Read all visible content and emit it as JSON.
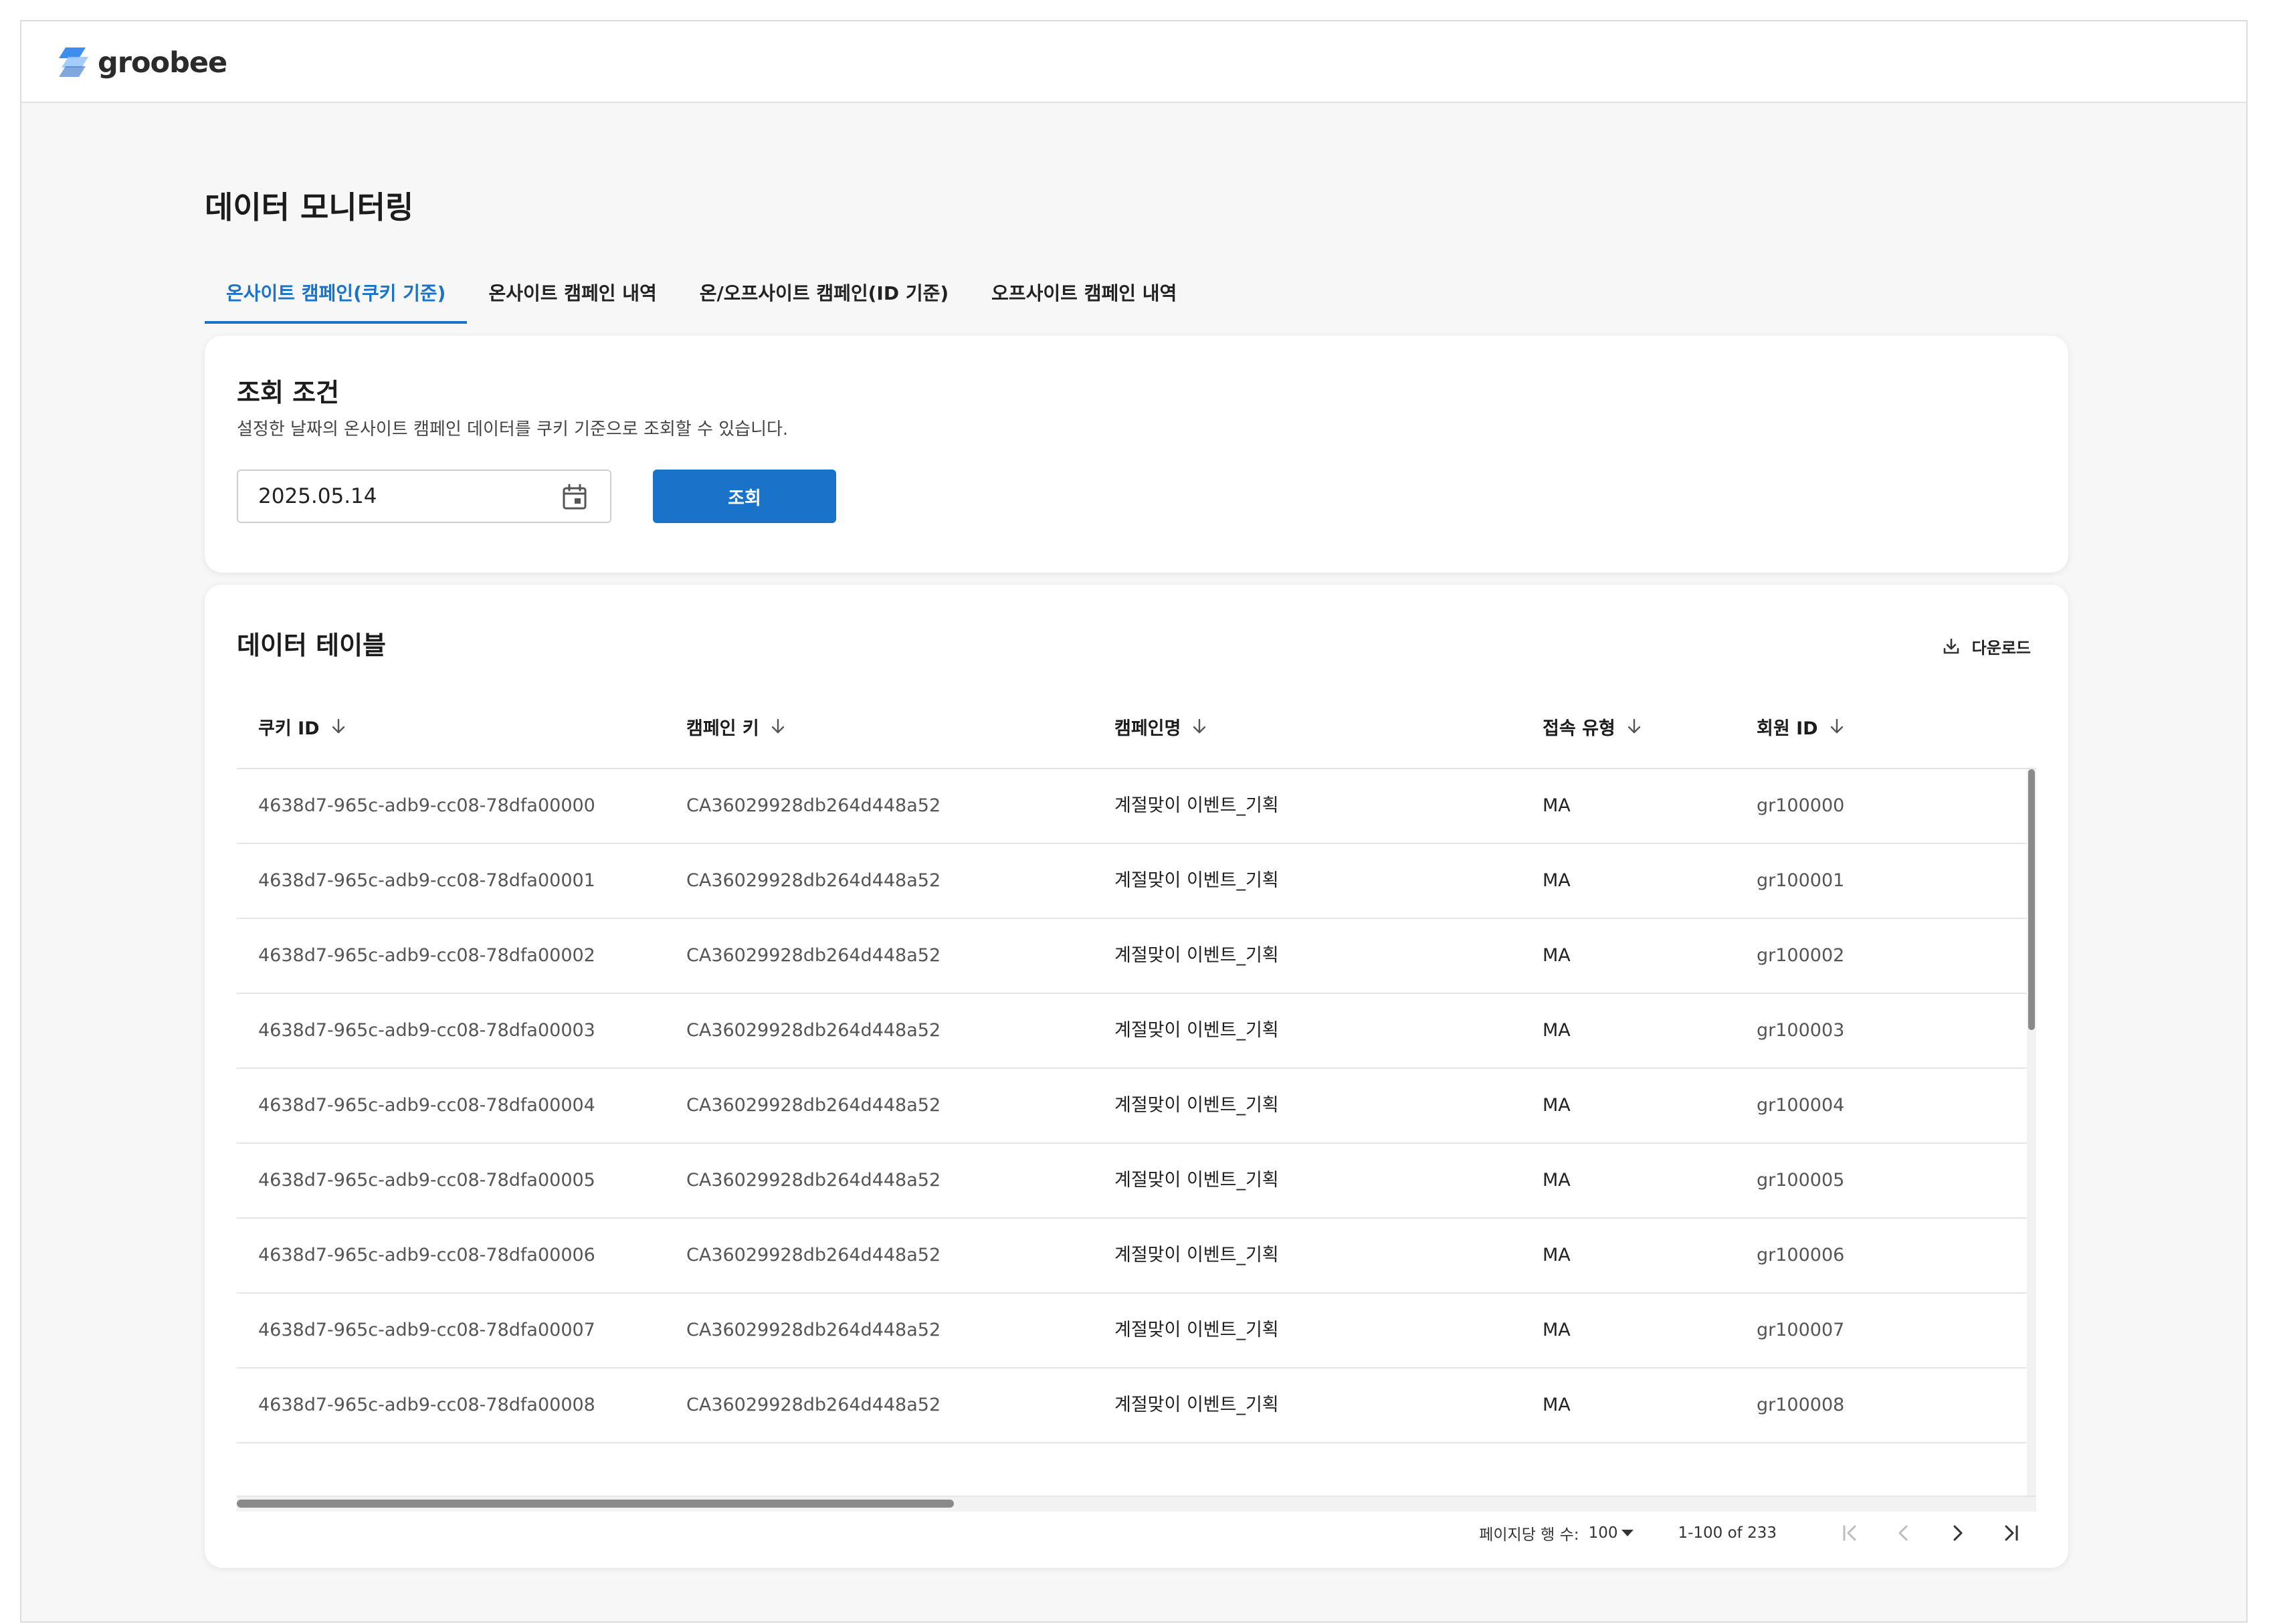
{
  "brand": {
    "name": "groobee",
    "logo_colors": [
      "#3d8df0",
      "#9bc6ff",
      "#1a5fc4"
    ]
  },
  "page": {
    "title": "데이터 모니터링"
  },
  "tabs": [
    {
      "label": "온사이트 캠페인(쿠키 기준)",
      "active": true
    },
    {
      "label": "온사이트 캠페인 내역",
      "active": false
    },
    {
      "label": "온/오프사이트 캠페인(ID 기준)",
      "active": false
    },
    {
      "label": "오프사이트 캠페인 내역",
      "active": false
    }
  ],
  "query": {
    "title": "조회 조건",
    "description": "설정한 날짜의 온사이트 캠페인 데이터를 쿠키 기준으로 조회할 수 있습니다.",
    "date_value": "2025.05.14",
    "date_icon": "calendar-icon",
    "search_label": "조회"
  },
  "table": {
    "title": "데이터 테이블",
    "download_label": "다운로드",
    "download_icon": "download-icon",
    "sort_icon": "arrow-down-icon",
    "columns": [
      "쿠키 ID",
      "캠페인 키",
      "캠페인명",
      "접속 유형",
      "회원 ID"
    ],
    "rows": [
      [
        "4638d7-965c-adb9-cc08-78dfa00000",
        "CA36029928db264d448a52",
        "계절맞이 이벤트_기획",
        "MA",
        "gr100000"
      ],
      [
        "4638d7-965c-adb9-cc08-78dfa00001",
        "CA36029928db264d448a52",
        "계절맞이 이벤트_기획",
        "MA",
        "gr100001"
      ],
      [
        "4638d7-965c-adb9-cc08-78dfa00002",
        "CA36029928db264d448a52",
        "계절맞이 이벤트_기획",
        "MA",
        "gr100002"
      ],
      [
        "4638d7-965c-adb9-cc08-78dfa00003",
        "CA36029928db264d448a52",
        "계절맞이 이벤트_기획",
        "MA",
        "gr100003"
      ],
      [
        "4638d7-965c-adb9-cc08-78dfa00004",
        "CA36029928db264d448a52",
        "계절맞이 이벤트_기획",
        "MA",
        "gr100004"
      ],
      [
        "4638d7-965c-adb9-cc08-78dfa00005",
        "CA36029928db264d448a52",
        "계절맞이 이벤트_기획",
        "MA",
        "gr100005"
      ],
      [
        "4638d7-965c-adb9-cc08-78dfa00006",
        "CA36029928db264d448a52",
        "계절맞이 이벤트_기획",
        "MA",
        "gr100006"
      ],
      [
        "4638d7-965c-adb9-cc08-78dfa00007",
        "CA36029928db264d448a52",
        "계절맞이 이벤트_기획",
        "MA",
        "gr100007"
      ],
      [
        "4638d7-965c-adb9-cc08-78dfa00008",
        "CA36029928db264d448a52",
        "계절맞이 이벤트_기획",
        "MA",
        "gr100008"
      ]
    ]
  },
  "pagination": {
    "rows_per_page_label": "페이지당 행 수:",
    "rows_per_page_value": "100",
    "range_text": "1-100 of 233",
    "first_icon": "first-page-icon",
    "prev_icon": "chevron-left-icon",
    "next_icon": "chevron-right-icon",
    "last_icon": "last-page-icon"
  },
  "colors": {
    "accent": "#1a73c9",
    "page_background": "#f7f7f7",
    "card_background": "#ffffff",
    "disabled_icon": "#bdbdbd"
  }
}
